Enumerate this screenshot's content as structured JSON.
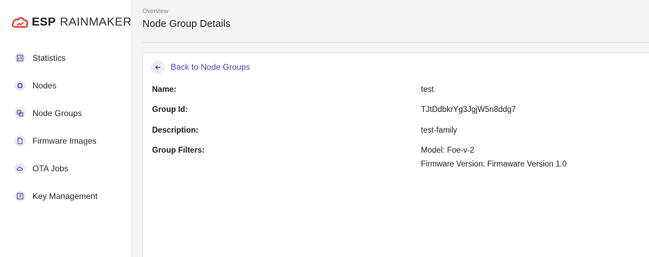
{
  "brand": {
    "esp": "ESP",
    "rainmaker": "RAINMAKER",
    "color": "#e5473c"
  },
  "sidebar": {
    "items": [
      {
        "label": "Statistics",
        "icon": "bar-chart-icon"
      },
      {
        "label": "Nodes",
        "icon": "chip-icon"
      },
      {
        "label": "Node Groups",
        "icon": "group-icon"
      },
      {
        "label": "Firmware Images",
        "icon": "file-icon"
      },
      {
        "label": "OTA Jobs",
        "icon": "cloud-icon"
      },
      {
        "label": "Key Management",
        "icon": "key-icon"
      }
    ]
  },
  "header": {
    "breadcrumb": "Overview",
    "title": "Node Group Details"
  },
  "card": {
    "back_label": "Back to Node Groups",
    "details": {
      "name_label": "Name:",
      "name_value": "test",
      "group_id_label": "Group Id:",
      "group_id_value": "TJtDdbkrYg3JgjW5n8ddg7",
      "description_label": "Description:",
      "description_value": "test-family",
      "filters_label": "Group Filters:",
      "filters": [
        "Model: Foe-v-2",
        "Firmware Version: Firmaware Version 1.0"
      ]
    }
  },
  "colors": {
    "accent": "#5b3fb3",
    "icon_bg": "#ece8f6"
  }
}
